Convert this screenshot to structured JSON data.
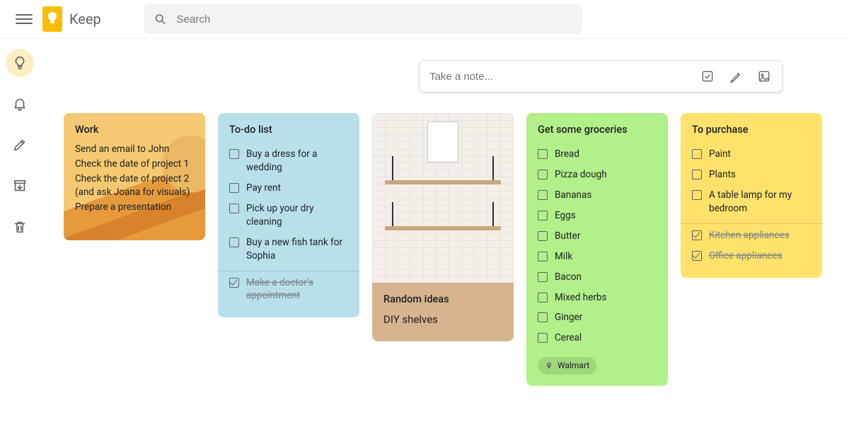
{
  "header": {
    "app_name": "Keep",
    "search_placeholder": "Search"
  },
  "sidebar": {
    "items": [
      {
        "name": "notes",
        "icon": "bulb-icon",
        "active": true
      },
      {
        "name": "reminders",
        "icon": "bell-icon",
        "active": false
      },
      {
        "name": "edit-labels",
        "icon": "pencil-icon",
        "active": false
      },
      {
        "name": "archive",
        "icon": "archive-icon",
        "active": false
      },
      {
        "name": "trash",
        "icon": "trash-icon",
        "active": false
      }
    ]
  },
  "takenote": {
    "placeholder": "Take a note...",
    "tools": [
      "checkbox-icon",
      "brush-icon",
      "image-icon"
    ]
  },
  "notes": [
    {
      "id": "work",
      "kind": "text",
      "bg": "#f5c971",
      "title": "Work",
      "lines": [
        "Send an email to John",
        "Check the date of project 1",
        "Check the date of project 2 (and ask Joana for visuals)",
        "Prepare a presentation"
      ]
    },
    {
      "id": "todo",
      "kind": "checklist",
      "bg": "#b9dfeb",
      "title": "To-do list",
      "items": [
        {
          "text": "Buy a dress for a wedding",
          "done": false
        },
        {
          "text": "Pay rent",
          "done": false
        },
        {
          "text": "Pick up your dry cleaning",
          "done": false
        },
        {
          "text": "Buy a new fish tank for Sophia",
          "done": false
        }
      ],
      "completed_items": [
        {
          "text": "Make a doctor's appointment",
          "done": true
        }
      ]
    },
    {
      "id": "random",
      "kind": "image",
      "bg": "#d7b48e",
      "title": "Random ideas",
      "subtitle": "DIY shelves"
    },
    {
      "id": "groceries",
      "kind": "checklist",
      "bg": "#b2f08a",
      "title": "Get some groceries",
      "items": [
        {
          "text": "Bread",
          "done": false
        },
        {
          "text": "Pizza dough",
          "done": false
        },
        {
          "text": "Bananas",
          "done": false
        },
        {
          "text": "Eggs",
          "done": false
        },
        {
          "text": "Butter",
          "done": false
        },
        {
          "text": "Milk",
          "done": false
        },
        {
          "text": "Bacon",
          "done": false
        },
        {
          "text": "Mixed herbs",
          "done": false
        },
        {
          "text": "Ginger",
          "done": false
        },
        {
          "text": "Cereal",
          "done": false
        }
      ],
      "tag": {
        "icon": "pin-icon",
        "label": "Walmart"
      }
    },
    {
      "id": "purchase",
      "kind": "checklist",
      "bg": "#ffe26b",
      "title": "To purchase",
      "items": [
        {
          "text": "Paint",
          "done": false
        },
        {
          "text": "Plants",
          "done": false
        },
        {
          "text": "A table lamp for my bedroom",
          "done": false
        }
      ],
      "completed_items": [
        {
          "text": "Kitchen appliances",
          "done": true
        },
        {
          "text": "Office appliances",
          "done": true
        }
      ]
    }
  ]
}
